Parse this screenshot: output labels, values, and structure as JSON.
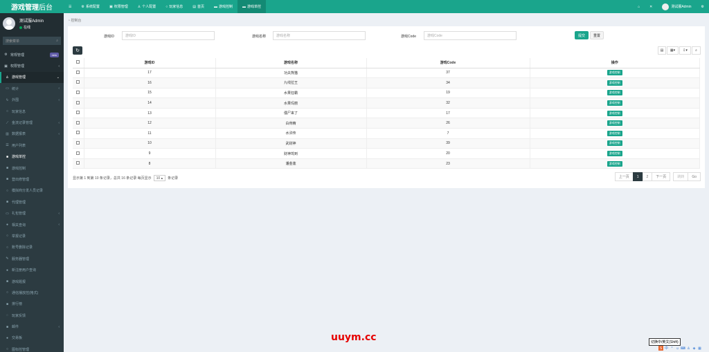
{
  "app": {
    "title_bold": "游戏管理",
    "title_light": "后台"
  },
  "user": {
    "name": "测试服Admin",
    "status": "在线"
  },
  "sidebar": {
    "search_placeholder": "搜索菜单",
    "items": [
      {
        "label": "常规管理",
        "icon": "gear-icon",
        "glyph": "⚙",
        "badge": "new",
        "type": "top"
      },
      {
        "label": "权限管理",
        "icon": "group-icon",
        "glyph": "▣",
        "arrow": "‹",
        "type": "top"
      },
      {
        "label": "游戏管理",
        "icon": "user-icon",
        "glyph": "♙",
        "arrow": "⌄",
        "type": "active-parent"
      },
      {
        "label": "统计",
        "icon": "chart-icon",
        "glyph": "▭",
        "arrow": "‹",
        "type": "sub"
      },
      {
        "label": "外围",
        "icon": "bolt-icon",
        "glyph": "ϟ",
        "arrow": "‹",
        "type": "sub"
      },
      {
        "label": "玩家信息",
        "icon": "circle-icon",
        "glyph": "○",
        "type": "sub"
      },
      {
        "label": "金流记录管理",
        "icon": "line-chart-icon",
        "glyph": "⟋",
        "arrow": "‹",
        "type": "sub"
      },
      {
        "label": "数据报表",
        "icon": "bar-chart-icon",
        "glyph": "▥",
        "arrow": "‹",
        "type": "sub"
      },
      {
        "label": "用户列表",
        "icon": "list-icon",
        "glyph": "☰",
        "type": "sub"
      },
      {
        "label": "游戏单控",
        "icon": "square-icon",
        "glyph": "■",
        "type": "sub current"
      },
      {
        "label": "游戏控制",
        "icon": "square-icon",
        "glyph": "■",
        "type": "sub"
      },
      {
        "label": "登出修管理",
        "icon": "square-icon",
        "glyph": "■",
        "type": "sub"
      },
      {
        "label": "模拟商分发人员记录",
        "icon": "circle-icon",
        "glyph": "○",
        "type": "sub"
      },
      {
        "label": "代理管理",
        "icon": "square-icon",
        "glyph": "■",
        "type": "sub"
      },
      {
        "label": "礼包管理",
        "icon": "card-icon",
        "glyph": "▭",
        "arrow": "‹",
        "type": "sub"
      },
      {
        "label": "相关查询",
        "icon": "dot-icon",
        "glyph": "●",
        "arrow": "‹",
        "type": "sub"
      },
      {
        "label": "举报记录",
        "icon": "circle-icon",
        "glyph": "○",
        "type": "sub"
      },
      {
        "label": "账号删除记录",
        "icon": "circle-icon",
        "glyph": "○",
        "type": "sub"
      },
      {
        "label": "服务器管理",
        "icon": "wrench-icon",
        "glyph": "✎",
        "type": "sub"
      },
      {
        "label": "新注册用户查询",
        "icon": "dot-icon",
        "glyph": "●",
        "type": "sub"
      },
      {
        "label": "游戏题报",
        "icon": "square-icon",
        "glyph": "■",
        "type": "sub"
      },
      {
        "label": "通信播放控(格式)",
        "icon": "circle-icon",
        "glyph": "○",
        "type": "sub"
      },
      {
        "label": "排行榜",
        "icon": "square-icon",
        "glyph": "■",
        "type": "sub"
      },
      {
        "label": "玩家反馈",
        "icon": "chat-icon",
        "glyph": "◌",
        "type": "sub"
      },
      {
        "label": "邮件",
        "icon": "square-icon",
        "glyph": "■",
        "arrow": "‹",
        "type": "sub"
      },
      {
        "label": "交易板",
        "icon": "dot-icon",
        "glyph": "●",
        "type": "sub"
      },
      {
        "label": "图标控管理",
        "icon": "circle-icon",
        "glyph": "○",
        "type": "sub"
      }
    ]
  },
  "topbar": {
    "menu_icon": "☰",
    "items": [
      {
        "label": "系统配置",
        "glyph": "⚙",
        "icon": "gear-icon"
      },
      {
        "label": "权限管理",
        "glyph": "▣",
        "icon": "group-icon"
      },
      {
        "label": "个人配置",
        "glyph": "♙",
        "icon": "user-icon"
      },
      {
        "label": "玩家信息",
        "glyph": "○",
        "icon": "circle-icon"
      },
      {
        "label": "首页",
        "glyph": "▤",
        "icon": "home-icon"
      },
      {
        "label": "游戏控制",
        "glyph": "▬",
        "icon": "card-icon"
      },
      {
        "label": "游戏单控",
        "glyph": "▬",
        "icon": "card-icon",
        "active": true
      }
    ],
    "right_user": "测试服Admin"
  },
  "breadcrumb": "控制台",
  "filters": {
    "game_id_label": "游戏ID",
    "game_id_placeholder": "游戏ID",
    "game_name_label": "游戏名称",
    "game_name_placeholder": "游戏名称",
    "game_code_label": "游戏Code",
    "game_code_placeholder": "游戏Code",
    "submit": "提交",
    "reset": "重置"
  },
  "table": {
    "headers": [
      "游戏ID",
      "游戏名称",
      "游戏Code",
      "操作"
    ],
    "action_label": "游戏控制",
    "rows": [
      {
        "id": "17",
        "name": "功夫熊猫",
        "code": "37"
      },
      {
        "id": "16",
        "name": "九线拉王",
        "code": "34"
      },
      {
        "id": "15",
        "name": "水果狂霸",
        "code": "19"
      },
      {
        "id": "14",
        "name": "水果玛丽",
        "code": "32"
      },
      {
        "id": "13",
        "name": "僵尸来了",
        "code": "17"
      },
      {
        "id": "12",
        "name": "白骨精",
        "code": "26"
      },
      {
        "id": "11",
        "name": "水浒传",
        "code": "7"
      },
      {
        "id": "10",
        "name": "武财神",
        "code": "39"
      },
      {
        "id": "9",
        "name": "财神驾到",
        "code": "20"
      },
      {
        "id": "8",
        "name": "潘金莲",
        "code": "23"
      }
    ]
  },
  "pagination": {
    "info_prefix": "显示第 1 到第 10 条记录，总共 16 条记录 每页显示",
    "page_size": "10",
    "info_suffix": "条记录",
    "prev": "上一页",
    "pages": [
      "1",
      "2"
    ],
    "next": "下一页",
    "jump_placeholder": "跳转",
    "go": "Go"
  },
  "watermark": "uuym.cc",
  "ime_tip": "切换中/英文(Shift)",
  "colors": {
    "accent": "#1aa58c",
    "sidebar_bg": "#222d32",
    "dark_button": "#2c3b41"
  }
}
